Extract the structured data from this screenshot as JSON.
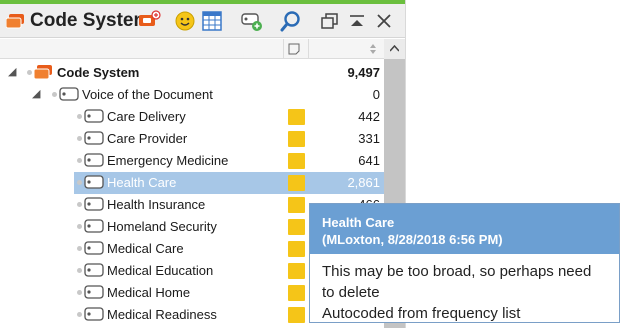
{
  "panel": {
    "title": "Code System",
    "accent_color": "#6bbf3e",
    "toolbar_icons": [
      "code-system-activate-icon",
      "emoticon-icon",
      "table-view-icon",
      "new-code-icon",
      "search-icon",
      "undock-icon",
      "collapse-icon",
      "close-icon"
    ]
  },
  "columns": {
    "memo_header_icon": "memo-icon",
    "count_header_icon": "sort-icon",
    "scroll_up_icon": "scroll-up-arrow"
  },
  "tree": [
    {
      "label": "Code System",
      "count": "9,497",
      "level": 0,
      "bold": true,
      "expanded": true,
      "memo": false,
      "selected": false,
      "icon": "code-system-root-icon"
    },
    {
      "label": "Voice of the Document",
      "count": "0",
      "level": 1,
      "bold": false,
      "expanded": true,
      "memo": false,
      "selected": false,
      "icon": "code-tag-icon"
    },
    {
      "label": "Care Delivery",
      "count": "442",
      "level": 2,
      "memo": true,
      "selected": false,
      "icon": "code-tag-icon"
    },
    {
      "label": "Care Provider",
      "count": "331",
      "level": 2,
      "memo": true,
      "selected": false,
      "icon": "code-tag-icon"
    },
    {
      "label": "Emergency Medicine",
      "count": "641",
      "level": 2,
      "memo": true,
      "selected": false,
      "icon": "code-tag-icon"
    },
    {
      "label": "Health Care",
      "count": "2,861",
      "level": 2,
      "memo": true,
      "selected": true,
      "icon": "code-tag-icon"
    },
    {
      "label": "Health Insurance",
      "count": "466",
      "level": 2,
      "memo": true,
      "selected": false,
      "icon": "code-tag-icon"
    },
    {
      "label": "Homeland Security",
      "count": "",
      "level": 2,
      "memo": true,
      "selected": false,
      "icon": "code-tag-icon"
    },
    {
      "label": "Medical Care",
      "count": "",
      "level": 2,
      "memo": true,
      "selected": false,
      "icon": "code-tag-icon"
    },
    {
      "label": "Medical Education",
      "count": "",
      "level": 2,
      "memo": true,
      "selected": false,
      "icon": "code-tag-icon"
    },
    {
      "label": "Medical Home",
      "count": "",
      "level": 2,
      "memo": true,
      "selected": false,
      "icon": "code-tag-icon"
    },
    {
      "label": "Medical Readiness",
      "count": "",
      "level": 2,
      "memo": true,
      "selected": false,
      "icon": "code-tag-icon"
    }
  ],
  "tooltip": {
    "title": "Health Care",
    "meta": "(MLoxton, 8/28/2018 6:56 PM)",
    "body_line1": "This may be too broad, so perhaps need",
    "body_line2": "to delete",
    "body_line3": "Autocoded from frequency list"
  }
}
